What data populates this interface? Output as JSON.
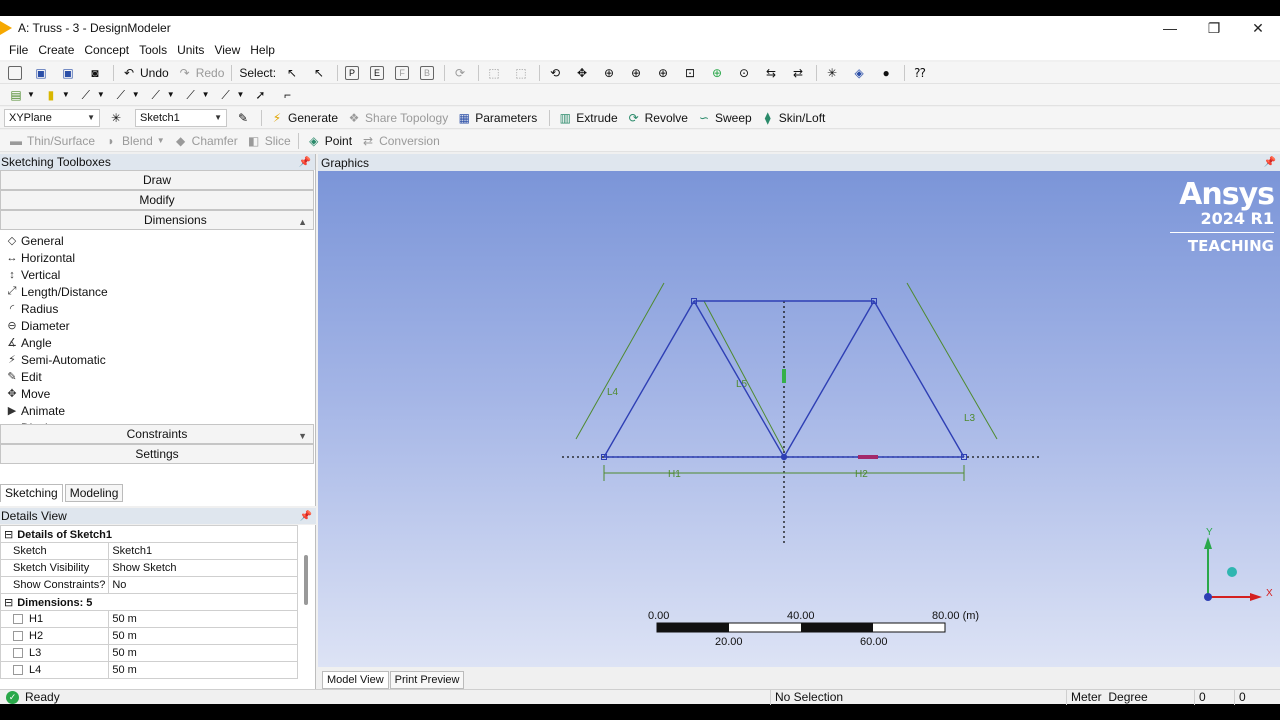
{
  "window": {
    "title": "A: Truss - 3 - DesignModeler",
    "controls": [
      "—",
      "❐",
      "✕"
    ]
  },
  "menu": [
    "File",
    "Create",
    "Concept",
    "Tools",
    "Units",
    "View",
    "Help"
  ],
  "toolbar1": {
    "undo": "Undo",
    "redo": "Redo",
    "select": "Select:"
  },
  "toolbar3": {
    "plane": "XYPlane",
    "sketch": "Sketch1",
    "generate": "Generate",
    "share_topology": "Share Topology",
    "parameters": "Parameters",
    "extrude": "Extrude",
    "revolve": "Revolve",
    "sweep": "Sweep",
    "skin_loft": "Skin/Loft"
  },
  "toolbar4": {
    "thin_surface": "Thin/Surface",
    "blend": "Blend",
    "chamfer": "Chamfer",
    "slice": "Slice",
    "point": "Point",
    "conversion": "Conversion"
  },
  "sketching": {
    "header": "Sketching Toolboxes",
    "sections": {
      "draw": "Draw",
      "modify": "Modify",
      "dimensions": "Dimensions",
      "constraints": "Constraints",
      "settings": "Settings"
    },
    "tools": [
      {
        "label": "General",
        "icon": "◇"
      },
      {
        "label": "Horizontal",
        "icon": "↔"
      },
      {
        "label": "Vertical",
        "icon": "↕"
      },
      {
        "label": "Length/Distance",
        "icon": "⤢"
      },
      {
        "label": "Radius",
        "icon": "◜"
      },
      {
        "label": "Diameter",
        "icon": "⊖"
      },
      {
        "label": "Angle",
        "icon": "∡"
      },
      {
        "label": "Semi-Automatic",
        "icon": "⚡"
      },
      {
        "label": "Edit",
        "icon": "✎"
      },
      {
        "label": "Move",
        "icon": "✥"
      },
      {
        "label": "Animate",
        "icon": "▶"
      },
      {
        "label": "Display",
        "icon": "▭"
      }
    ],
    "tabs": {
      "sketching": "Sketching",
      "modeling": "Modeling"
    }
  },
  "details": {
    "header": "Details View",
    "group1": "Details of Sketch1",
    "rows": [
      {
        "key": "Sketch",
        "value": "Sketch1"
      },
      {
        "key": "Sketch Visibility",
        "value": "Show Sketch"
      },
      {
        "key": "Show Constraints?",
        "value": "No"
      }
    ],
    "group2": "Dimensions: 5",
    "dims": [
      {
        "key": "H1",
        "value": "50 m"
      },
      {
        "key": "H2",
        "value": "50 m"
      },
      {
        "key": "L3",
        "value": "50 m"
      },
      {
        "key": "L4",
        "value": "50 m"
      }
    ]
  },
  "graphics": {
    "header": "Graphics",
    "logo": {
      "brand": "Ansys",
      "version": "2024 R1",
      "edition": "TEACHING"
    },
    "dim_labels": {
      "H1": "H1",
      "H2": "H2",
      "L3": "L3",
      "L4": "L4",
      "L5": "L5"
    },
    "scale": {
      "labels_top": [
        "0.00",
        "40.00",
        "80.00 (m)"
      ],
      "labels_bottom": [
        "20.00",
        "60.00"
      ]
    },
    "triad": {
      "x": "X",
      "y": "Y"
    },
    "tabs": {
      "model_view": "Model View",
      "print_preview": "Print Preview"
    },
    "colors": {
      "sketch_line": "#2e3fb4",
      "dimension": "#4e8a2e",
      "bg_top": "#7b95d8",
      "bg_bottom": "#dde3f5"
    }
  },
  "status": {
    "ready": "Ready",
    "selection": "No Selection",
    "units_length": "Meter",
    "units_angle": "Degree",
    "v1": "0",
    "v2": "0"
  }
}
